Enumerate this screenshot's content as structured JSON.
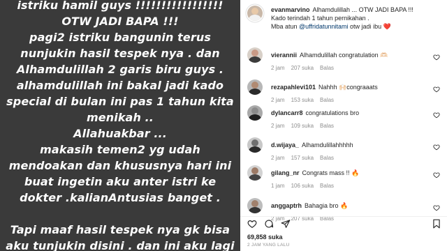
{
  "story": {
    "lines": [
      "istriku hamil guys !!!!!!!!!!!!!!!!!",
      "OTW JADI BAPA !!!",
      "pagi2 istriku bangunin terus",
      "nunjukin hasil tespek nya . dan",
      "Alhamdulillah 2 garis biru guys .",
      "alhamdulillah ini bakal jadi kado",
      "special di bulan ini pas 1 tahun kita",
      "menikah ..",
      "Allahuakbar ...",
      "makasih temen2 yg udah",
      "mendoakan dan khususnya hari ini",
      "buat ingetin aku anter istri ke",
      "dokter .kalianAntusias banget .",
      "",
      "Tapi maaf hasil tespek nya gk bisa",
      "aku tunjukin disini . dan ini aku lagi"
    ]
  },
  "caption": {
    "username": "evanmarvino",
    "text": "Alhamdulillah ... OTW JADI BAPA !!!",
    "line2": "Kado terindah 1 tahun pernikahan .",
    "line3_prefix": "Mba atun ",
    "mention": "@uffridatunnitami",
    "line3_suffix": " otw jadi ibu ❤️"
  },
  "comments": [
    {
      "username": "vierannii",
      "text": "Alhamdulillah congratulation 🫶🏻",
      "time": "2 jam",
      "likes": "207 suka",
      "reply": "Balas"
    },
    {
      "username": "rezapahlevi101",
      "text": "Nahhh 🙌🏻congraaats",
      "time": "2 jam",
      "likes": "153 suka",
      "reply": "Balas"
    },
    {
      "username": "dylancarr8",
      "text": "congratulations bro",
      "time": "2 jam",
      "likes": "109 suka",
      "reply": "Balas"
    },
    {
      "username": "d.wijaya_",
      "text": "Alhamdulillahhhhh",
      "time": "2 jam",
      "likes": "157 suka",
      "reply": "Balas"
    },
    {
      "username": "gilang_nr",
      "text": "Congrats mass !! 🔥",
      "time": "1 jam",
      "likes": "106 suka",
      "reply": "Balas"
    },
    {
      "username": "anggaptrh",
      "text": "Bahagia bro 🔥",
      "time": "2 jam",
      "likes": "207 suka",
      "reply": "Balas"
    }
  ],
  "footer": {
    "likes": "69,858 suka",
    "time": "2 JAM YANG LALU"
  },
  "icons": [
    "heart-icon",
    "comment-icon",
    "share-icon",
    "bookmark-icon"
  ],
  "colors": {
    "story_bg": "#3a3a3a",
    "mention": "#00376b",
    "muted": "#8e8e8e"
  }
}
